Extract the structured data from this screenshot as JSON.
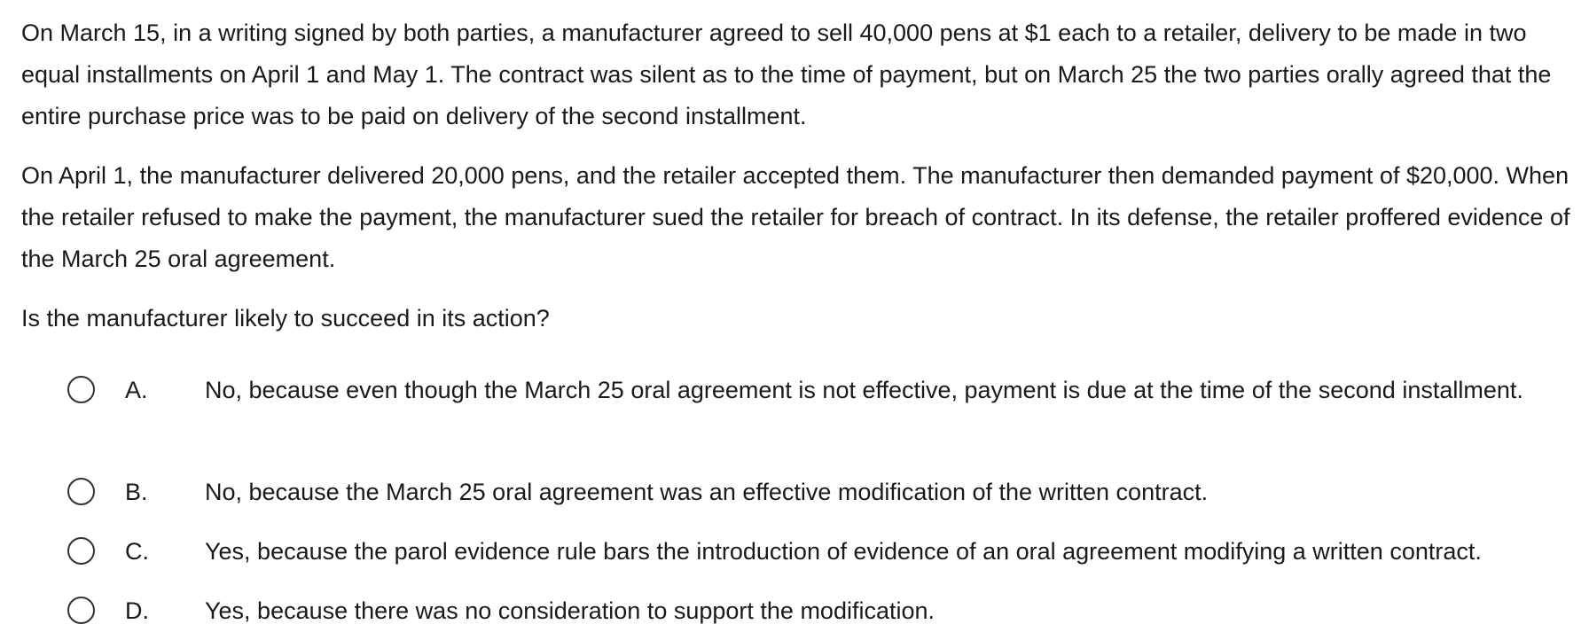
{
  "question": {
    "paragraphs": [
      "On March 15, in a writing signed by both parties, a manufacturer agreed to sell 40,000 pens at $1 each to a retailer, delivery to be made in two equal installments on April 1 and May 1.  The contract was silent as to the time of payment, but on March 25 the two parties orally agreed that the entire purchase price was to be paid on delivery of the second installment.",
      "On April 1, the manufacturer delivered 20,000 pens, and the retailer accepted them.  The manufacturer then demanded payment of $20,000.  When the retailer refused to make the payment, the manufacturer sued the retailer for breach of contract.  In its defense, the retailer proffered evidence of the March 25 oral agreement."
    ],
    "prompt": "Is the manufacturer likely to succeed in its action?"
  },
  "options": [
    {
      "letter": "A.",
      "text": "No, because even though the March 25 oral agreement is not effective, payment is due at the time of the second installment.",
      "selected": false
    },
    {
      "letter": "B.",
      "text": "No, because the March 25 oral agreement was an effective modification of the written contract.",
      "selected": false
    },
    {
      "letter": "C.",
      "text": "Yes, because the parol evidence rule bars the introduction of evidence of an oral agreement modifying a written contract.",
      "selected": false
    },
    {
      "letter": "D.",
      "text": "Yes, because there was no consideration to support the modification.",
      "selected": false
    }
  ]
}
